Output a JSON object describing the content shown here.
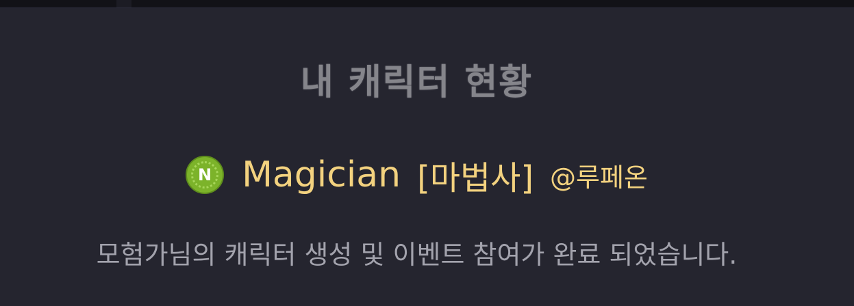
{
  "title": "내 캐릭터 현황",
  "character": {
    "server_badge": "N",
    "server_icon": "server-emblem-icon",
    "name": "Magician",
    "class": "[마법사]",
    "server": "@루페온"
  },
  "message": "모험가님의 캐릭터 생성 및 이벤트 참여가 완료 되었습니다.",
  "colors": {
    "background": "#25252f",
    "highlight": "#f3d27f",
    "title": "#85858b",
    "message": "#a3a3ad",
    "badge": "#7cb32a"
  }
}
